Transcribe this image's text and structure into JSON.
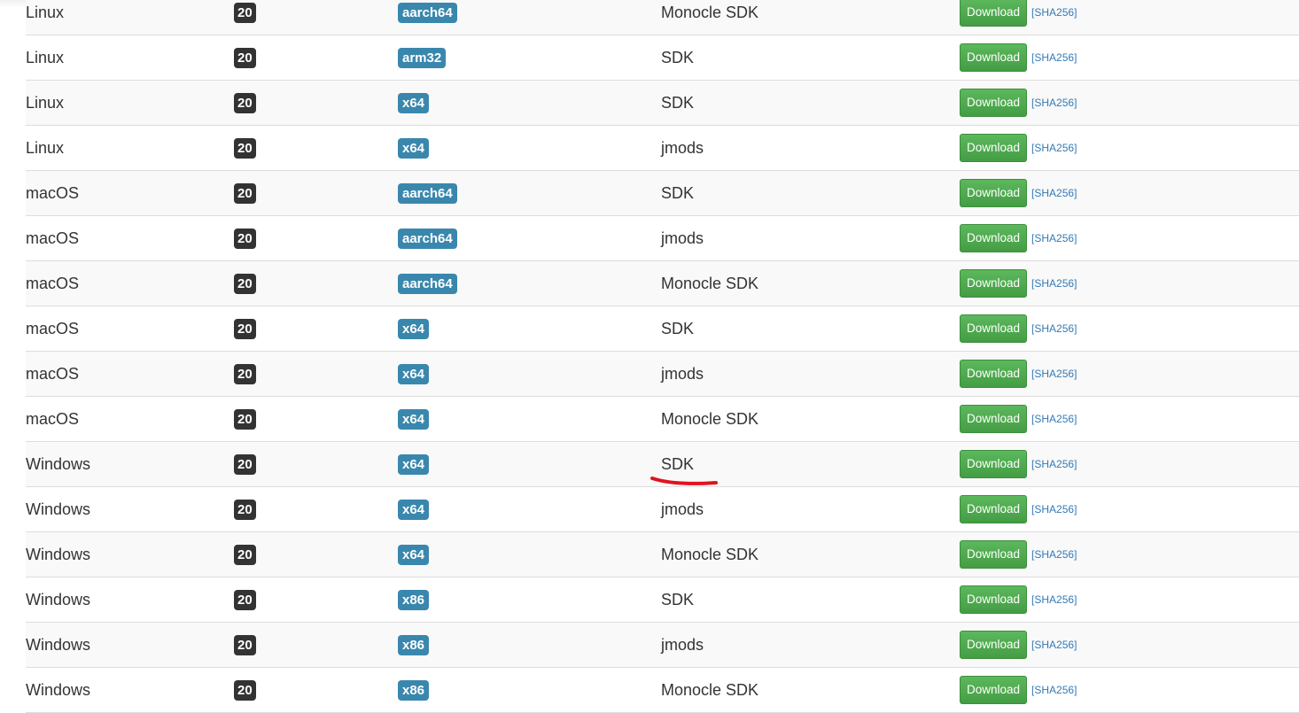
{
  "table": {
    "rows": [
      {
        "os": "Linux",
        "version": "20",
        "arch": "aarch64",
        "package": "Monocle SDK",
        "download": "Download",
        "checksum": "[SHA256]"
      },
      {
        "os": "Linux",
        "version": "20",
        "arch": "arm32",
        "package": "SDK",
        "download": "Download",
        "checksum": "[SHA256]"
      },
      {
        "os": "Linux",
        "version": "20",
        "arch": "x64",
        "package": "SDK",
        "download": "Download",
        "checksum": "[SHA256]"
      },
      {
        "os": "Linux",
        "version": "20",
        "arch": "x64",
        "package": "jmods",
        "download": "Download",
        "checksum": "[SHA256]"
      },
      {
        "os": "macOS",
        "version": "20",
        "arch": "aarch64",
        "package": "SDK",
        "download": "Download",
        "checksum": "[SHA256]"
      },
      {
        "os": "macOS",
        "version": "20",
        "arch": "aarch64",
        "package": "jmods",
        "download": "Download",
        "checksum": "[SHA256]"
      },
      {
        "os": "macOS",
        "version": "20",
        "arch": "aarch64",
        "package": "Monocle SDK",
        "download": "Download",
        "checksum": "[SHA256]"
      },
      {
        "os": "macOS",
        "version": "20",
        "arch": "x64",
        "package": "SDK",
        "download": "Download",
        "checksum": "[SHA256]"
      },
      {
        "os": "macOS",
        "version": "20",
        "arch": "x64",
        "package": "jmods",
        "download": "Download",
        "checksum": "[SHA256]"
      },
      {
        "os": "macOS",
        "version": "20",
        "arch": "x64",
        "package": "Monocle SDK",
        "download": "Download",
        "checksum": "[SHA256]"
      },
      {
        "os": "Windows",
        "version": "20",
        "arch": "x64",
        "package": "SDK",
        "download": "Download",
        "checksum": "[SHA256]"
      },
      {
        "os": "Windows",
        "version": "20",
        "arch": "x64",
        "package": "jmods",
        "download": "Download",
        "checksum": "[SHA256]"
      },
      {
        "os": "Windows",
        "version": "20",
        "arch": "x64",
        "package": "Monocle SDK",
        "download": "Download",
        "checksum": "[SHA256]"
      },
      {
        "os": "Windows",
        "version": "20",
        "arch": "x86",
        "package": "SDK",
        "download": "Download",
        "checksum": "[SHA256]"
      },
      {
        "os": "Windows",
        "version": "20",
        "arch": "x86",
        "package": "jmods",
        "download": "Download",
        "checksum": "[SHA256]"
      },
      {
        "os": "Windows",
        "version": "20",
        "arch": "x86",
        "package": "Monocle SDK",
        "download": "Download",
        "checksum": "[SHA256]"
      }
    ]
  },
  "colors": {
    "version_badge": "#333333",
    "arch_badge": "#3a87ad",
    "download_button": "#5cb85c",
    "link": "#337ab7",
    "annotation": "#e0141e"
  }
}
